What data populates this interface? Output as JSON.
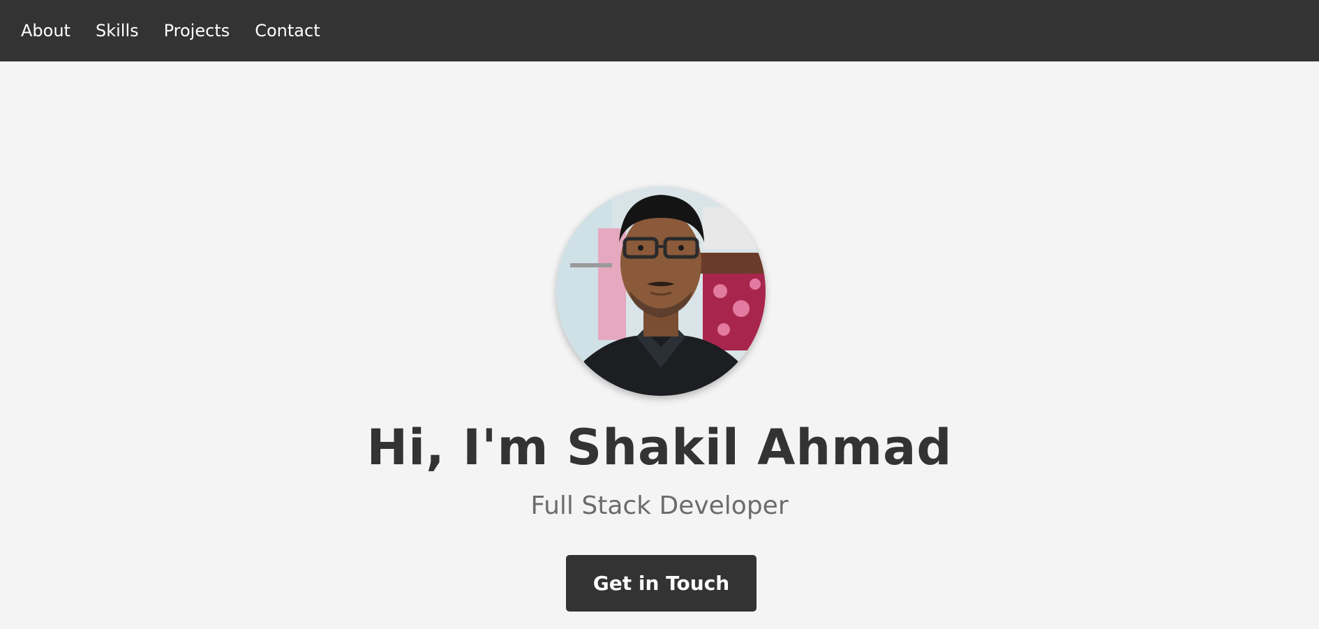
{
  "nav": {
    "items": [
      {
        "label": "About"
      },
      {
        "label": "Skills"
      },
      {
        "label": "Projects"
      },
      {
        "label": "Contact"
      }
    ]
  },
  "hero": {
    "title": "Hi, I'm Shakil Ahmad",
    "subtitle": "Full Stack Developer",
    "cta_label": "Get in Touch"
  },
  "colors": {
    "navbar_bg": "#333333",
    "page_bg": "#f4f4f4",
    "title": "#333333",
    "subtitle": "#6b6b6b",
    "button_bg": "#333333",
    "button_text": "#ffffff"
  }
}
